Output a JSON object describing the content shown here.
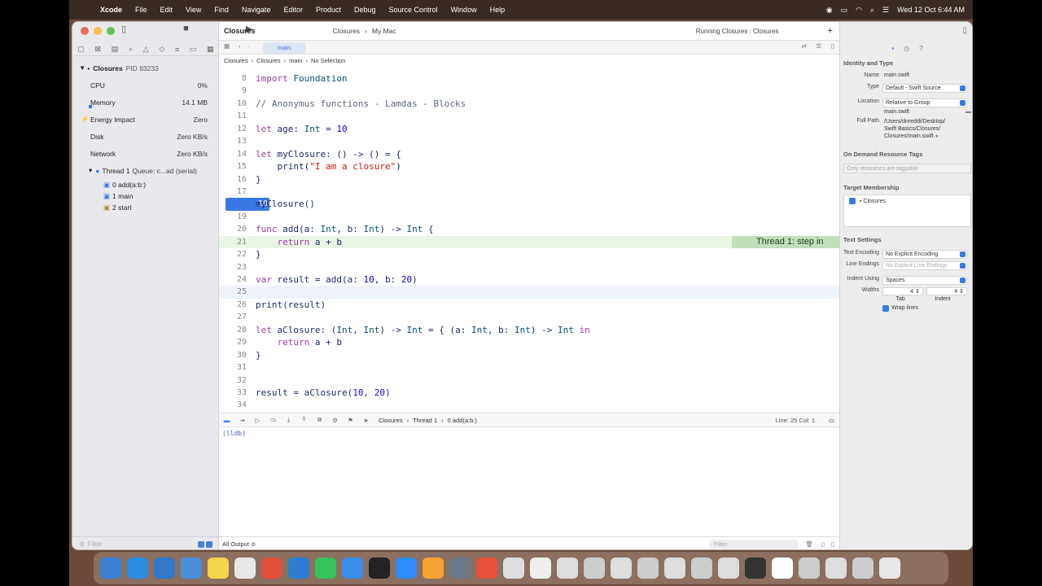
{
  "menubar": {
    "app": "Xcode",
    "items": [
      "File",
      "Edit",
      "View",
      "Find",
      "Navigate",
      "Editor",
      "Product",
      "Debug",
      "Source Control",
      "Window",
      "Help"
    ],
    "datetime": "Wed 12 Oct  6:44 AM"
  },
  "toolbar": {
    "title": "Closures",
    "scheme": "Closures",
    "destination": "My Mac",
    "status": "Running Closures : Closures"
  },
  "tab": {
    "label": "main"
  },
  "breadcrumb": [
    "Closures",
    "Closures",
    "main",
    "No Selection"
  ],
  "navigator": {
    "process": "Closures",
    "pid": "PID 83233",
    "gauges": [
      {
        "label": "CPU",
        "value": "0%"
      },
      {
        "label": "Memory",
        "value": "14.1 MB"
      },
      {
        "label": "Energy Impact",
        "value": "Zero"
      },
      {
        "label": "Disk",
        "value": "Zero KB/s"
      },
      {
        "label": "Network",
        "value": "Zero KB/s"
      }
    ],
    "thread": "Thread 1",
    "thread_queue": "Queue: c...ad (serial)",
    "frames": [
      "0 add(a:b:)",
      "1 main",
      "2 start"
    ],
    "filter_placeholder": "Filter"
  },
  "code": [
    {
      "n": "8",
      "t": "import Foundation"
    },
    {
      "n": "9",
      "t": ""
    },
    {
      "n": "10",
      "t": "// Anonymus functions - Lamdas - Blocks"
    },
    {
      "n": "11",
      "t": ""
    },
    {
      "n": "12",
      "t": "let age: Int = 10"
    },
    {
      "n": "13",
      "t": ""
    },
    {
      "n": "14",
      "t": "let myClosure: () -> () = {"
    },
    {
      "n": "15",
      "t": "    print(\"I am a closure\")"
    },
    {
      "n": "16",
      "t": "}"
    },
    {
      "n": "17",
      "t": ""
    },
    {
      "n": "18",
      "t": "myClosure()"
    },
    {
      "n": "19",
      "t": ""
    },
    {
      "n": "20",
      "t": "func add(a: Int, b: Int) -> Int {"
    },
    {
      "n": "21",
      "t": "    return a + b"
    },
    {
      "n": "22",
      "t": "}"
    },
    {
      "n": "23",
      "t": ""
    },
    {
      "n": "24",
      "t": "var result = add(a: 10, b: 20)"
    },
    {
      "n": "25",
      "t": ""
    },
    {
      "n": "26",
      "t": "print(result)"
    },
    {
      "n": "27",
      "t": ""
    },
    {
      "n": "28",
      "t": "let aClosure: (Int, Int) -> Int = { (a: Int, b: Int) -> Int in"
    },
    {
      "n": "29",
      "t": "    return a + b"
    },
    {
      "n": "30",
      "t": "}"
    },
    {
      "n": "31",
      "t": ""
    },
    {
      "n": "32",
      "t": ""
    },
    {
      "n": "33",
      "t": "result = aClosure(10, 20)"
    },
    {
      "n": "34",
      "t": ""
    }
  ],
  "step_badge": "Thread 1: step in",
  "debugbar": {
    "path": [
      "Closures",
      "Thread 1",
      "0 add(a:b:)"
    ],
    "position": "Line: 25  Col: 1"
  },
  "console": {
    "prompt": "(lldb)",
    "output_select": "All Output ≎",
    "filter_placeholder": "Filter"
  },
  "inspector": {
    "identity_title": "Identity and Type",
    "name_label": "Name",
    "name": "main.swift",
    "type_label": "Type",
    "type": "Default - Swift Source",
    "location_label": "Location",
    "location": "Relative to Group",
    "location_file": "main.swift",
    "fullpath_label": "Full Path",
    "fullpath": [
      "/Users/dnreddi/Desktop/",
      "Swift Basics/Closures/",
      "Closures/main.swift"
    ],
    "odr_title": "On Demand Resource Tags",
    "odr_placeholder": "Only resources are taggable",
    "target_title": "Target Membership",
    "target": "Closures",
    "text_title": "Text Settings",
    "encoding_label": "Text Encoding",
    "encoding": "No Explicit Encoding",
    "endings_label": "Line Endings",
    "endings": "No Explicit Line Endings",
    "indent_label": "Indent Using",
    "indent": "Spaces",
    "widths_label": "Widths",
    "tab_width": "4",
    "indent_width": "4",
    "tab_label": "Tab",
    "indent_label2": "Indent",
    "wrap": "Wrap lines"
  },
  "colors": {
    "accent": "#3b78e7",
    "exec_line": "#eaf5e6",
    "badge": "#bfe0b8"
  }
}
